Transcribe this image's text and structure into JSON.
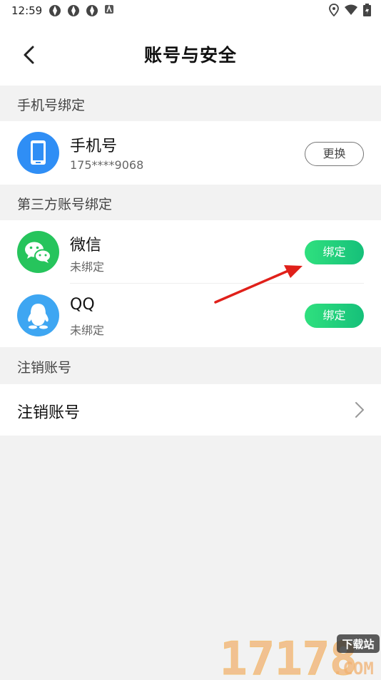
{
  "status_bar": {
    "time": "12:59"
  },
  "nav": {
    "title": "账号与安全"
  },
  "sections": {
    "phone_header": "手机号绑定",
    "third_party_header": "第三方账号绑定",
    "cancel_header": "注销账号"
  },
  "phone": {
    "title": "手机号",
    "number": "175****9068",
    "button": "更换"
  },
  "wechat": {
    "title": "微信",
    "status": "未绑定",
    "button": "绑定"
  },
  "qq": {
    "title": "QQ",
    "status": "未绑定",
    "button": "绑定"
  },
  "cancel": {
    "label": "注销账号"
  },
  "watermark": {
    "number": "17178",
    "tag": "下载站",
    "suffix": ".COM"
  },
  "colors": {
    "accent_green": "#1ccf7a",
    "phone_blue": "#2f8ef5",
    "wechat_green": "#26c45c",
    "qq_blue": "#3ea6f2",
    "arrow_red": "#e0201a"
  },
  "icons": {
    "back": "chevron-left-icon",
    "phone": "phone-icon",
    "wechat": "wechat-icon",
    "qq": "qq-icon",
    "chevron": "chevron-right-icon"
  }
}
